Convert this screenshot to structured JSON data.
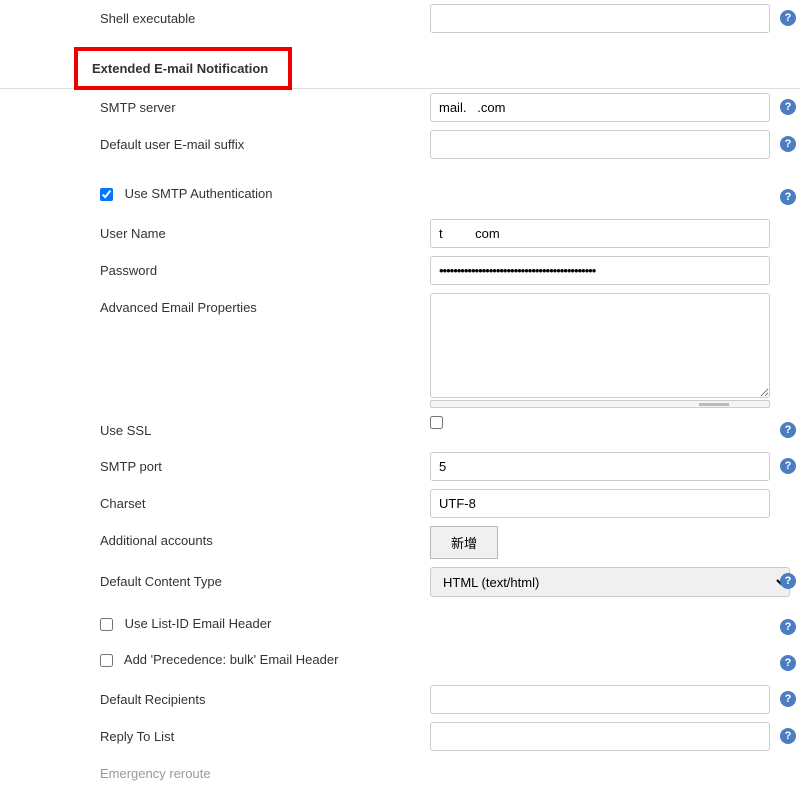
{
  "labels": {
    "shell_executable": "Shell executable",
    "section_header": "Extended E-mail Notification",
    "smtp_server": "SMTP server",
    "default_suffix": "Default user E-mail suffix",
    "use_smtp_auth": "Use SMTP Authentication",
    "user_name": "User Name",
    "password": "Password",
    "advanced_props": "Advanced Email Properties",
    "use_ssl": "Use SSL",
    "smtp_port": "SMTP port",
    "charset": "Charset",
    "additional_accounts": "Additional accounts",
    "default_content_type": "Default Content Type",
    "use_list_id": "Use List-ID Email Header",
    "add_precedence": "Add 'Precedence: bulk' Email Header",
    "default_recipients": "Default Recipients",
    "reply_to_list": "Reply To List",
    "emergency": "Emergency reroute"
  },
  "values": {
    "smtp_server": "mail.   .com",
    "user_name": "t         com",
    "password": "••••••••••••••••••••••••••••••••••••••••••••",
    "smtp_port": "5",
    "charset": "UTF-8",
    "add_button": "新增",
    "content_type": "HTML (text/html)"
  }
}
